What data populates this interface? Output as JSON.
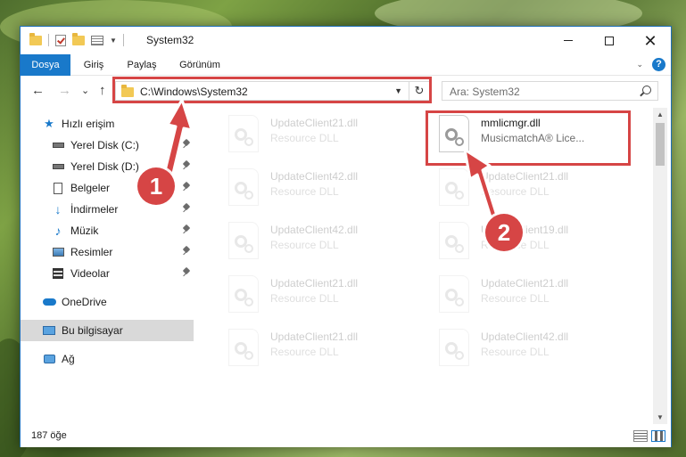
{
  "window": {
    "title": "System32",
    "controls": {
      "minimize": "—",
      "maximize": "☐",
      "close": "✕"
    }
  },
  "ribbon": {
    "tabs": [
      "Dosya",
      "Giriş",
      "Paylaş",
      "Görünüm"
    ],
    "active_tab": "Dosya",
    "help": "?"
  },
  "navigation": {
    "back": "←",
    "forward": "→",
    "recent": "⌄",
    "up": "↑",
    "address": "C:\\Windows\\System32",
    "refresh": "↻",
    "search_placeholder": "Ara: System32"
  },
  "sidebar": {
    "quick_access": "Hızlı erişim",
    "items": [
      {
        "label": "Yerel Disk (C:)",
        "icon": "drive-icon",
        "pinned": true
      },
      {
        "label": "Yerel Disk (D:)",
        "icon": "drive-icon",
        "pinned": true
      },
      {
        "label": "Belgeler",
        "icon": "documents-icon",
        "pinned": true
      },
      {
        "label": "İndirmeler",
        "icon": "download-icon",
        "pinned": true
      },
      {
        "label": "Müzik",
        "icon": "music-icon",
        "pinned": true
      },
      {
        "label": "Resimler",
        "icon": "pictures-icon",
        "pinned": true
      },
      {
        "label": "Videolar",
        "icon": "videos-icon",
        "pinned": true
      }
    ],
    "onedrive": "OneDrive",
    "this_pc": "Bu bilgisayar",
    "network": "Ağ"
  },
  "files": [
    {
      "name": "UpdateClient21.dll",
      "type": "Resource DLL",
      "faded": true
    },
    {
      "name": "mmlicmgr.dll",
      "type": "MusicmatchA® Lice...",
      "faded": false
    },
    {
      "name": "UpdateClient42.dll",
      "type": "Resource DLL",
      "faded": true
    },
    {
      "name": "UpdateClient21.dll",
      "type": "Resource DLL",
      "faded": true
    },
    {
      "name": "UpdateClient42.dll",
      "type": "Resource DLL",
      "faded": true
    },
    {
      "name": "UpdateClient19.dll",
      "type": "Resource DLL",
      "faded": true
    },
    {
      "name": "UpdateClient21.dll",
      "type": "Resource DLL",
      "faded": true
    },
    {
      "name": "UpdateClient21.dll",
      "type": "Resource DLL",
      "faded": true
    },
    {
      "name": "UpdateClient21.dll",
      "type": "Resource DLL",
      "faded": true
    },
    {
      "name": "UpdateClient42.dll",
      "type": "Resource DLL",
      "faded": true
    }
  ],
  "status": {
    "item_count": "187 öğe"
  },
  "annotations": {
    "step1": "1",
    "step2": "2",
    "color": "#d64545"
  }
}
